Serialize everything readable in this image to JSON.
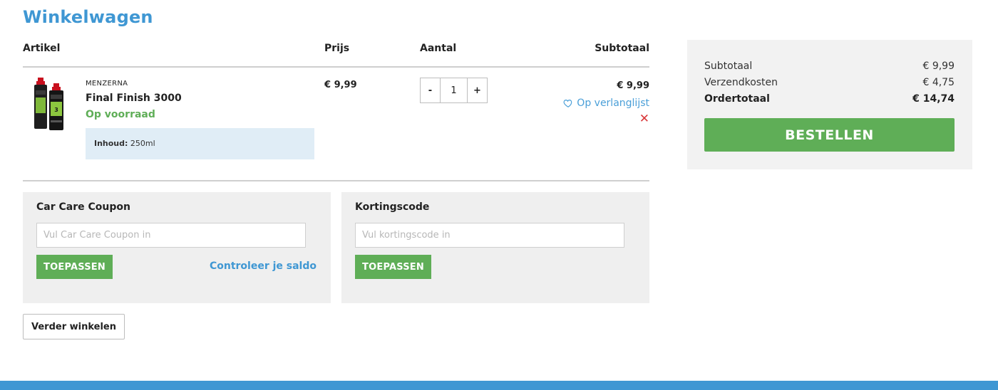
{
  "page": {
    "title": "Winkelwagen"
  },
  "cart": {
    "headers": {
      "artikel": "Artikel",
      "prijs": "Prijs",
      "aantal": "Aantal",
      "subtotaal": "Subtotaal"
    },
    "items": [
      {
        "brand": "MENZERNA",
        "name": "Final Finish 3000",
        "stock": "Op voorraad",
        "option_label": "Inhoud:",
        "option_value": "250ml",
        "price": "€ 9,99",
        "quantity": "1",
        "qty_minus": "-",
        "qty_plus": "+",
        "subtotal": "€ 9,99",
        "wishlist_label": "Op verlanglijst",
        "remove_glyph": "✕"
      }
    ]
  },
  "coupon": {
    "title": "Car Care Coupon",
    "placeholder": "Vul Car Care Coupon in",
    "apply_label": "TOEPASSEN",
    "check_balance_label": "Controleer je saldo"
  },
  "discount": {
    "title": "Kortingscode",
    "placeholder": "Vul kortingscode in",
    "apply_label": "TOEPASSEN"
  },
  "continue_label": "Verder winkelen",
  "summary": {
    "subtotal_label": "Subtotaal",
    "subtotal_value": "€ 9,99",
    "shipping_label": "Verzendkosten",
    "shipping_value": "€ 4,75",
    "total_label": "Ordertotaal",
    "total_value": "€ 14,74",
    "order_label": "BESTELLEN"
  },
  "colors": {
    "accent": "#3f97d3",
    "success": "#5fae57",
    "remove": "#d9383a",
    "option_bg": "#e0edf6",
    "panel_bg": "#efefef"
  },
  "icons": {
    "wishlist": "heart-outline-icon",
    "remove": "close-icon"
  }
}
